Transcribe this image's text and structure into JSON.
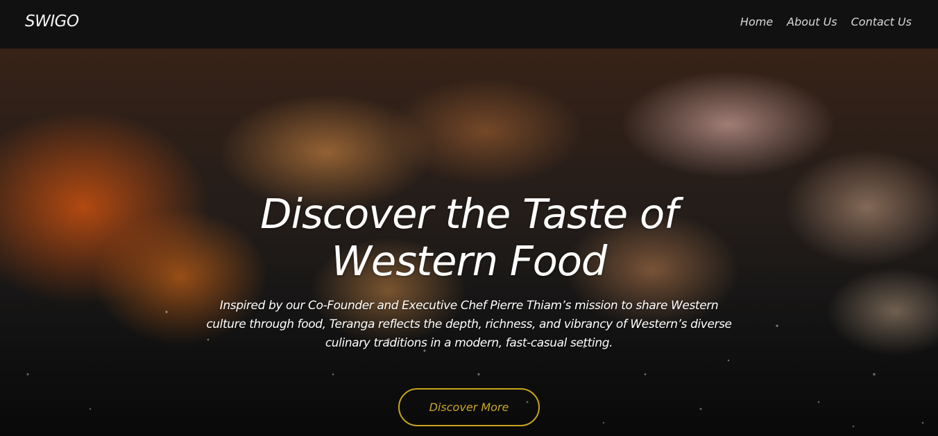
{
  "nav": {
    "brand": "SWIGO",
    "links": [
      "Home",
      "About Us",
      "Contact Us"
    ]
  },
  "hero": {
    "headline": "Discover the Taste of Western Food",
    "description": "Inspired by our Co-Founder and Executive Chef Pierre Thiam’s mission to share Western culture through food, Teranga reflects the depth, richness, and vibrancy of Western’s diverse culinary traditions in a modern, fast-casual setting.",
    "cta_label": "Discover More"
  },
  "colors": {
    "navbar_bg": "#111111",
    "text": "#ffffff",
    "accent": "#c8a41c"
  }
}
